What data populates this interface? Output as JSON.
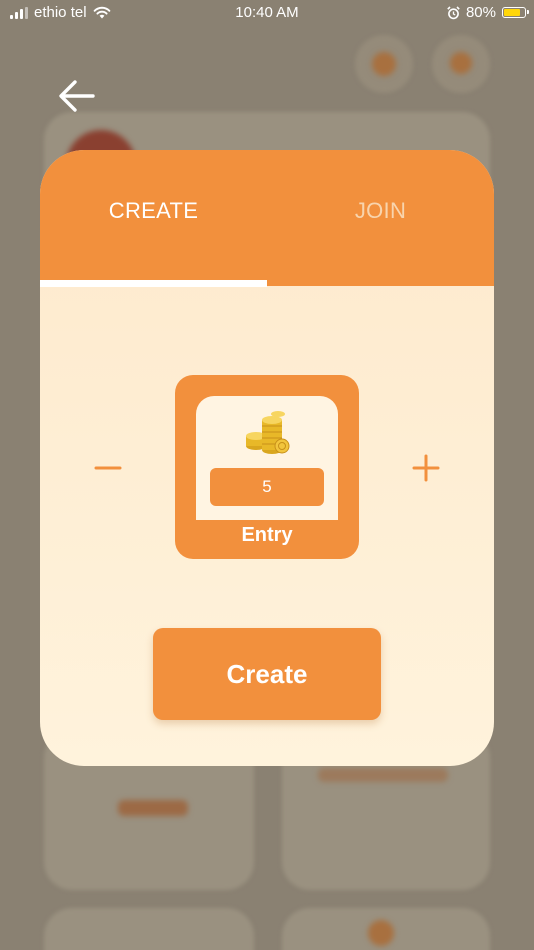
{
  "status_bar": {
    "carrier": "ethio tel",
    "time": "10:40 AM",
    "battery": "80%",
    "battery_level": 0.8,
    "icons": [
      "signal-icon",
      "wifi-icon",
      "alarm-icon",
      "battery-icon"
    ]
  },
  "navigation": {
    "back_icon": "arrow-left-icon"
  },
  "tabs": [
    {
      "label": "CREATE",
      "active": true
    },
    {
      "label": "JOIN",
      "active": false
    }
  ],
  "entry": {
    "value": "5",
    "label": "Entry",
    "decrement_icon": "minus-icon",
    "increment_icon": "plus-icon",
    "image_icon": "gold-coins-icon"
  },
  "actions": {
    "create_label": "Create"
  },
  "colors": {
    "accent": "#f2903d",
    "panel_bg": "#fde9cc",
    "overlay": "#8a8172",
    "tab_inactive_text": "#f8d4ad"
  }
}
